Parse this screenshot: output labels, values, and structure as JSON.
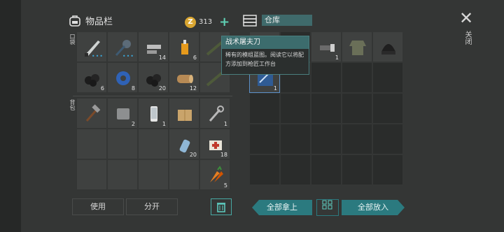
{
  "inventory": {
    "title": "物品栏",
    "coins": "313",
    "pocket_label": "口袋",
    "backpack_label": "背包"
  },
  "warehouse": {
    "title": "仓库"
  },
  "close": {
    "label": "关闭"
  },
  "pocket_items": [
    {
      "name": "machete-icon",
      "count": "",
      "dots": "•••"
    },
    {
      "name": "mace-icon",
      "count": "",
      "dots": "•••"
    },
    {
      "name": "bolts-icon",
      "count": "14",
      "dots": ""
    },
    {
      "name": "glue-icon",
      "count": "6",
      "dots": ""
    },
    {
      "name": "rifle-icon",
      "count": "",
      "dots": ""
    },
    {
      "name": "coal-icon",
      "count": "6",
      "dots": ""
    },
    {
      "name": "tape-icon",
      "count": "8",
      "dots": ""
    },
    {
      "name": "coal-icon",
      "count": "20",
      "dots": ""
    },
    {
      "name": "wood-icon",
      "count": "12",
      "dots": ""
    },
    {
      "name": "rifle-icon",
      "count": "",
      "dots": ""
    }
  ],
  "backpack_items": [
    {
      "name": "hammer-icon",
      "count": "",
      "dots": ""
    },
    {
      "name": "metal-plate-icon",
      "count": "2",
      "dots": ""
    },
    {
      "name": "phone-icon",
      "count": "1",
      "dots": ""
    },
    {
      "name": "box-icon",
      "count": "",
      "dots": ""
    },
    {
      "name": "wrench-icon",
      "count": "1",
      "dots": ""
    },
    {
      "name": "empty",
      "count": "",
      "dots": ""
    },
    {
      "name": "empty",
      "count": "",
      "dots": ""
    },
    {
      "name": "empty",
      "count": "",
      "dots": ""
    },
    {
      "name": "water-bottle-icon",
      "count": "20",
      "dots": ""
    },
    {
      "name": "bandage-icon",
      "count": "18",
      "dots": ""
    },
    {
      "name": "empty",
      "count": "",
      "dots": ""
    },
    {
      "name": "empty",
      "count": "",
      "dots": ""
    },
    {
      "name": "empty",
      "count": "",
      "dots": ""
    },
    {
      "name": "empty",
      "count": "",
      "dots": ""
    },
    {
      "name": "carrot-icon",
      "count": "5",
      "dots": ""
    }
  ],
  "warehouse_items": [
    {
      "name": "blueprint-icon",
      "count": "",
      "dots": ""
    },
    {
      "name": "empty",
      "count": "",
      "dots": ""
    },
    {
      "name": "flashlight-icon",
      "count": "1",
      "dots": ""
    },
    {
      "name": "jacket-icon",
      "count": "",
      "dots": ""
    },
    {
      "name": "beanie-icon",
      "count": "",
      "dots": ""
    },
    {
      "name": "blueprint-icon",
      "count": "1",
      "dots": ""
    }
  ],
  "tooltip": {
    "title": "战术屠夫刀",
    "desc": "稀有的模组蓝图。阅读它以将配方添加到枪匠工作台"
  },
  "buttons": {
    "use": "使用",
    "split": "分开",
    "take_all": "全部拿上",
    "put_all": "全部放入"
  },
  "colors": {
    "accent": "#2b7a7f",
    "tooltip_header": "#3c6c6d",
    "coin": "#d9a631"
  }
}
